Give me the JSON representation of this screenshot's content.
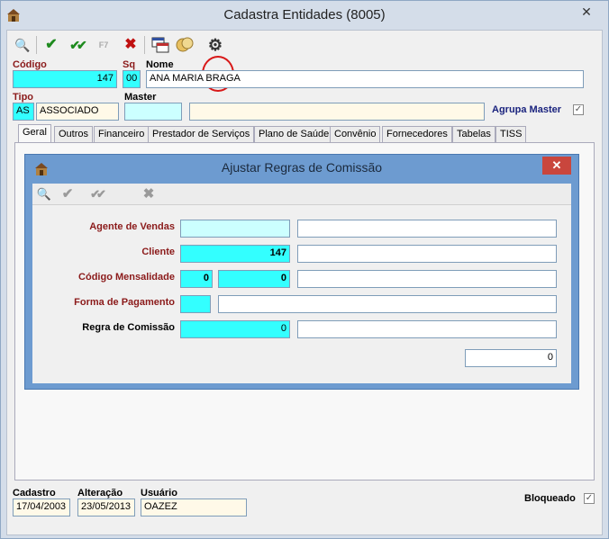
{
  "window": {
    "title": "Cadastra Entidades (8005)",
    "close_glyph": "✕"
  },
  "toolbar": {
    "search_icon": "🔍",
    "confirm_icon": "✔",
    "confirm_all_icon": "✔✔",
    "f7_label": "F7",
    "cancel_icon": "✖",
    "gear_icon": "⚙"
  },
  "form": {
    "codigo_label": "Código",
    "codigo_value": "147",
    "sq_label": "Sq",
    "sq_value": "00",
    "nome_label": "Nome",
    "nome_value": "ANA MARIA BRAGA",
    "tipo_label": "Tipo",
    "tipo_code": "AS",
    "tipo_desc": "ASSOCIADO",
    "master_label": "Master",
    "master_code": "",
    "master_desc": "",
    "agrupa_label": "Agrupa Master",
    "agrupa_checked": "✓"
  },
  "tabs": [
    "Geral",
    "Outros",
    "Financeiro",
    "Prestador de Serviços",
    "Plano de Saúde",
    "Convênio",
    "Fornecedores",
    "Tabelas",
    "TISS"
  ],
  "footer": {
    "cadastro_label": "Cadastro",
    "cadastro_value": "17/04/2003",
    "alteracao_label": "Alteração",
    "alteracao_value": "23/05/2013",
    "usuario_label": "Usuário",
    "usuario_value": "OAZEZ",
    "bloqueado_label": "Bloqueado",
    "bloqueado_checked": "✓"
  },
  "dialog": {
    "title": "Ajustar Regras de Comissão",
    "close_glyph": "✕",
    "toolbar": {
      "search_icon": "🔍",
      "confirm_icon": "✔",
      "confirm_all_icon": "✔✔",
      "cancel_icon": "✖"
    },
    "agente_label": "Agente de Vendas",
    "agente_value": "",
    "agente_desc": "",
    "cliente_label": "Cliente",
    "cliente_value": "147",
    "cliente_desc": "",
    "codmens_label": "Código Mensalidade",
    "codmens_value1": "0",
    "codmens_value2": "0",
    "codmens_desc": "",
    "forma_label": "Forma de Pagamento",
    "forma_value": "",
    "forma_desc": "",
    "regra_label": "Regra de Comissão",
    "regra_value": "0",
    "regra_desc": "",
    "total_value": "0"
  },
  "colors": {
    "accent_cyan": "#33ffff",
    "label_red": "#8b1a1a",
    "dialog_blue": "#6d9bd0",
    "close_red": "#c9463d"
  }
}
